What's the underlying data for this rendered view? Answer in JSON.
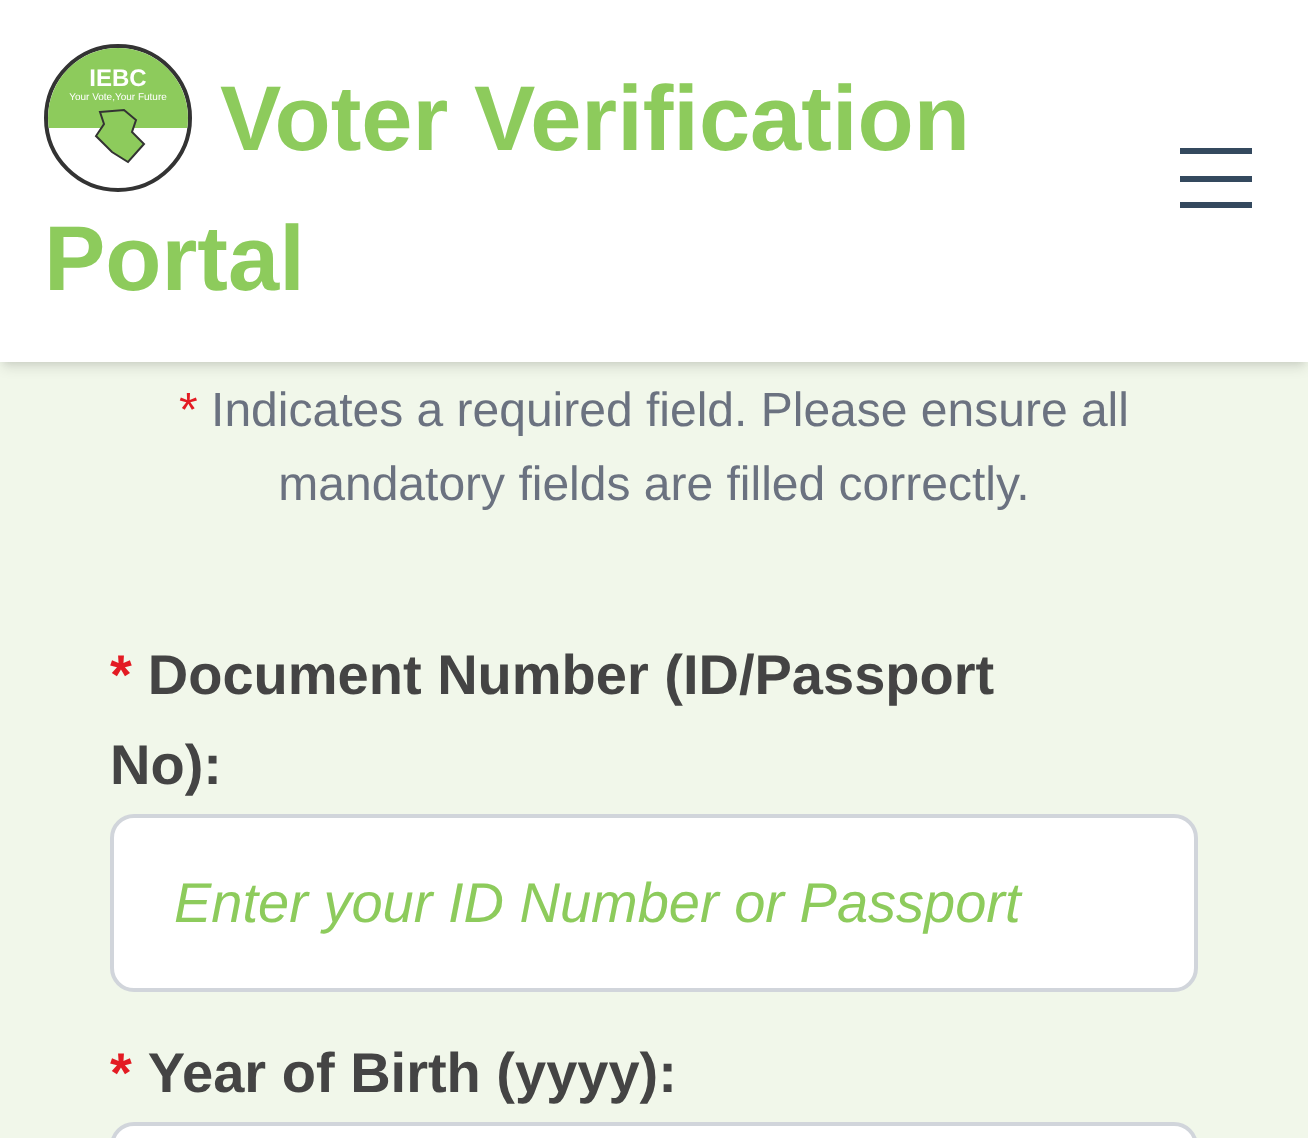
{
  "header": {
    "logo": {
      "acronym": "IEBC",
      "tagline": "Your Vote,Your Future"
    },
    "title": "Voter Verification Portal"
  },
  "notice": {
    "marker": "*",
    "text": "Indicates a required field. Please ensure all mandatory fields are filled correctly."
  },
  "fields": [
    {
      "label": "Document Number (ID/Passport No):",
      "required": true,
      "placeholder": "Enter your ID Number or Passport"
    },
    {
      "label": "Year of Birth (yyyy):",
      "required": true
    }
  ]
}
